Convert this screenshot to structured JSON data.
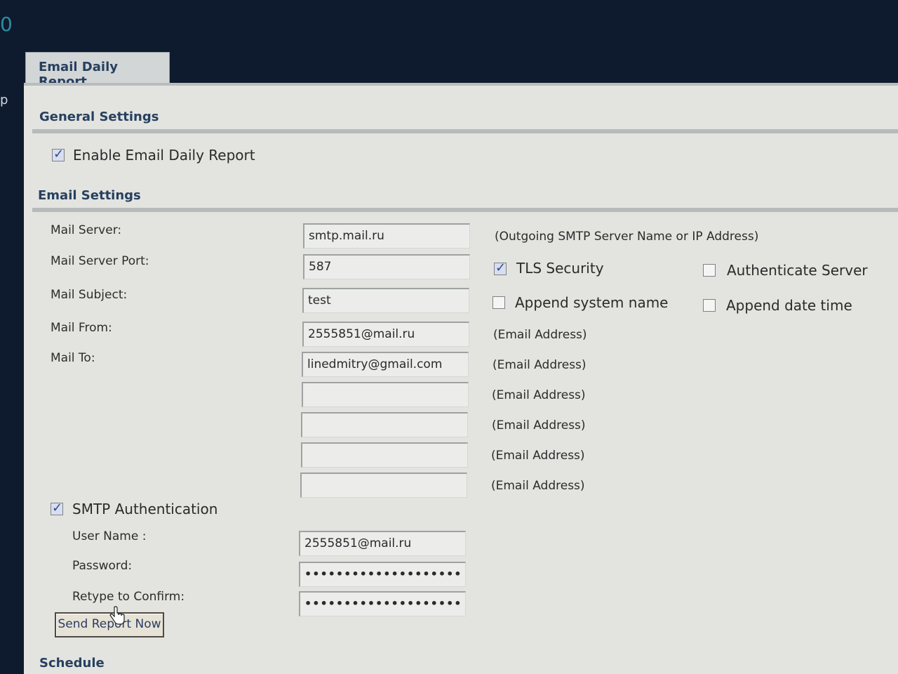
{
  "corner_text": "0",
  "side_text": "p",
  "tab": {
    "label": "Email Daily Report"
  },
  "general": {
    "title": "General Settings",
    "enable_label": "Enable Email Daily Report",
    "enable_checked": true
  },
  "email": {
    "title": "Email Settings",
    "labels": {
      "server": "Mail Server:",
      "port": "Mail Server Port:",
      "subject": "Mail Subject:",
      "from": "Mail From:",
      "to": "Mail To:"
    },
    "values": {
      "server": "smtp.mail.ru",
      "port": "587",
      "subject": "test",
      "from": "2555851@mail.ru",
      "to": [
        "linedmitry@gmail.com",
        "",
        "",
        "",
        ""
      ]
    },
    "hints": {
      "server": "(Outgoing SMTP Server Name or IP Address)",
      "email": "(Email Address)"
    },
    "options": {
      "tls_label": "TLS Security",
      "tls_checked": true,
      "auth_server_label": "Authenticate Server",
      "auth_server_checked": false,
      "append_system_label": "Append system name",
      "append_system_checked": false,
      "append_date_label": "Append date time",
      "append_date_checked": false
    }
  },
  "smtp": {
    "label": "SMTP Authentication",
    "checked": true,
    "username_label": "User Name :",
    "username_value": "2555851@mail.ru",
    "password_label": "Password:",
    "password_value": "••••••••••••••••••••",
    "confirm_label": "Retype to Confirm:",
    "confirm_value": "••••••••••••••••••••"
  },
  "send_button": "Send Report Now",
  "schedule_title": "Schedule"
}
